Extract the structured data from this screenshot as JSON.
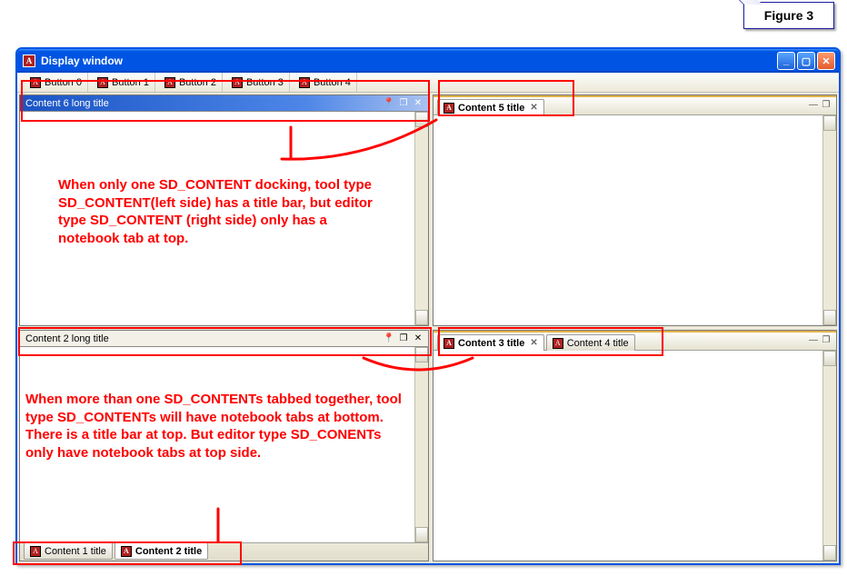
{
  "figure_label": "Figure 3",
  "window": {
    "title": "Display window",
    "app_icon_glyph": "A"
  },
  "toolbar": {
    "buttons": [
      "Button 0",
      "Button 1",
      "Button 2",
      "Button 3",
      "Button 4"
    ],
    "icon_glyph": "A"
  },
  "panes": {
    "top_left": {
      "title": "Content 6 long title"
    },
    "top_right": {
      "tabs": [
        {
          "label": "Content 5 title",
          "active": true
        }
      ]
    },
    "bottom_left": {
      "title": "Content 2 long title",
      "bottom_tabs": [
        {
          "label": "Content 1 title",
          "active": false
        },
        {
          "label": "Content 2 title",
          "active": true
        }
      ]
    },
    "bottom_right": {
      "tabs": [
        {
          "label": "Content 3 title",
          "active": true
        },
        {
          "label": "Content 4 title",
          "active": false
        }
      ]
    }
  },
  "annotations": {
    "text1": "When only one SD_CONTENT docking, tool type SD_CONTENT(left side) has a title bar, but editor type SD_CONTENT (right side) only has a notebook tab at top.",
    "text2": "When more than one SD_CONTENTs tabbed together, tool type SD_CONTENTs will have notebook tabs at bottom. There is a title bar at top. But editor type SD_CONENTs only have notebook tabs at top side."
  },
  "icons": {
    "pin": "📌",
    "max": "❐",
    "close": "✕",
    "min_dash": "—",
    "tab_close": "✕"
  }
}
